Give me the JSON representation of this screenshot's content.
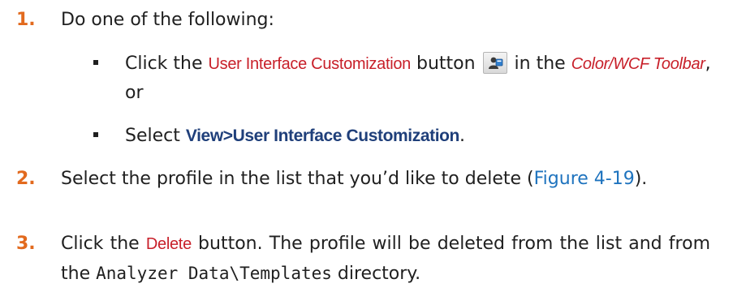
{
  "steps": [
    {
      "number": "1.",
      "intro": "Do one of the following:",
      "bullets": [
        {
          "pre": "Click the ",
          "ui_ref": "User Interface Customization",
          "mid": " button ",
          "icon": "user-interface-customization-icon",
          "post1": " in the ",
          "toolbar_ref": "Color/WCF Toolbar",
          "post2": ", or"
        },
        {
          "pre": "Select ",
          "menu_path": "View>User Interface Customization",
          "post": "."
        }
      ]
    },
    {
      "number": "2.",
      "pre": "Select the profile in the list that you’d like to delete (",
      "link": "Figure 4-19",
      "post": ")."
    },
    {
      "number": "3.",
      "pre": "Click the ",
      "ui_ref": "Delete",
      "mid": " button. The profile will be deleted from the list and from the ",
      "code": "Analyzer Data\\Templates",
      "post": " directory."
    }
  ],
  "colors": {
    "step_number": "#e26a1e",
    "ui_reference": "#c8202a",
    "menu_path": "#1f3f7a",
    "link": "#1e73be"
  }
}
